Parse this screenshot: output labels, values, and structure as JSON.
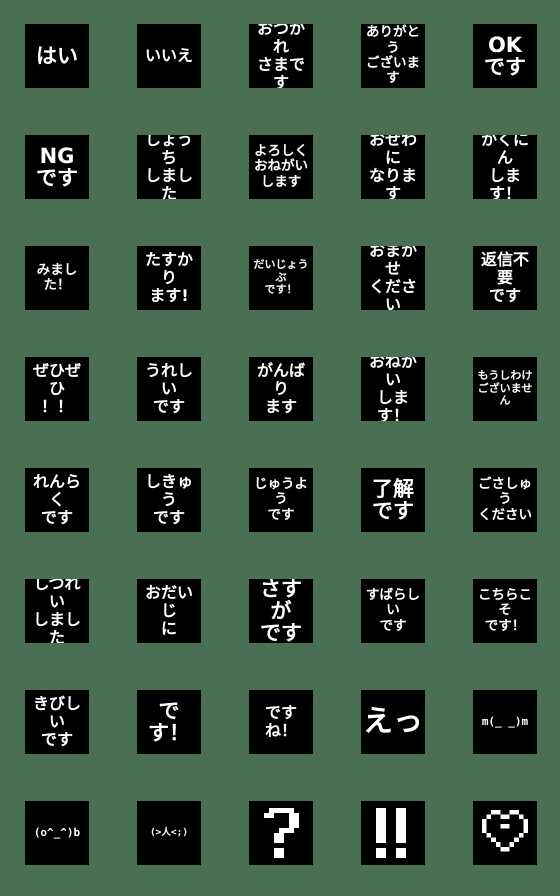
{
  "sheet": {
    "background_color": "#4a7054",
    "tile_color": "#000000",
    "text_color": "#ffffff",
    "columns": 5,
    "rows": 8,
    "tile_size_px": 64,
    "tile_count": 40,
    "style": "pixel bitmap font"
  },
  "stickers": [
    {
      "id": "r1c1",
      "text": "はい",
      "lines": [
        "はい"
      ],
      "size": "xl",
      "kind": "text"
    },
    {
      "id": "r1c2",
      "text": "いいえ",
      "lines": [
        "いいえ"
      ],
      "size": "lg",
      "kind": "text"
    },
    {
      "id": "r1c3",
      "text": "おつかれさまです",
      "lines": [
        "おつかれ",
        "さまです"
      ],
      "size": "lg",
      "kind": "text"
    },
    {
      "id": "r1c4",
      "text": "ありがとうございます",
      "lines": [
        "ありがとう",
        "ございます"
      ],
      "size": "md",
      "kind": "text"
    },
    {
      "id": "r1c5",
      "text": "OKです",
      "lines": [
        "OK",
        "です"
      ],
      "size": "xl",
      "kind": "text"
    },
    {
      "id": "r2c1",
      "text": "NGです",
      "lines": [
        "NG",
        "です"
      ],
      "size": "xl",
      "kind": "text"
    },
    {
      "id": "r2c2",
      "text": "しょうちしました",
      "lines": [
        "しょうち",
        "しました"
      ],
      "size": "lg",
      "kind": "text"
    },
    {
      "id": "r2c3",
      "text": "よろしくおねがいします",
      "lines": [
        "よろしく",
        "おねがい",
        "します"
      ],
      "size": "md",
      "kind": "text"
    },
    {
      "id": "r2c4",
      "text": "おせわになります",
      "lines": [
        "おせわに",
        "なります"
      ],
      "size": "lg",
      "kind": "text"
    },
    {
      "id": "r2c5",
      "text": "かくにんします！",
      "lines": [
        "かくにん",
        "します！"
      ],
      "size": "lg",
      "kind": "text"
    },
    {
      "id": "r3c1",
      "text": "みました！",
      "lines": [
        "みました！"
      ],
      "size": "md",
      "kind": "text"
    },
    {
      "id": "r3c2",
      "text": "たすかります!",
      "lines": [
        "たすかり",
        "ます!"
      ],
      "size": "lg",
      "kind": "text"
    },
    {
      "id": "r3c3",
      "text": "だいじょうぶです！",
      "lines": [
        "だいじょうぶ",
        "です！"
      ],
      "size": "sm",
      "kind": "text"
    },
    {
      "id": "r3c4",
      "text": "おまかせください",
      "lines": [
        "おまかせ",
        "ください"
      ],
      "size": "lg",
      "kind": "text"
    },
    {
      "id": "r3c5",
      "text": "返信不要です",
      "lines": [
        "返信不要",
        "です"
      ],
      "size": "lg",
      "kind": "text"
    },
    {
      "id": "r4c1",
      "text": "ぜひぜひ！！",
      "lines": [
        "ぜひぜひ",
        "！！"
      ],
      "size": "lg",
      "kind": "text"
    },
    {
      "id": "r4c2",
      "text": "うれしいです",
      "lines": [
        "うれしい",
        "です"
      ],
      "size": "lg",
      "kind": "text"
    },
    {
      "id": "r4c3",
      "text": "がんばります",
      "lines": [
        "がんばり",
        "ます"
      ],
      "size": "lg",
      "kind": "text"
    },
    {
      "id": "r4c4",
      "text": "おねがいします！",
      "lines": [
        "おねがい",
        "します！"
      ],
      "size": "lg",
      "kind": "text"
    },
    {
      "id": "r4c5",
      "text": "もうしわけございません",
      "lines": [
        "もうしわけ",
        "ございません"
      ],
      "size": "sm",
      "kind": "text"
    },
    {
      "id": "r5c1",
      "text": "れんらくです",
      "lines": [
        "れんらく",
        "です"
      ],
      "size": "lg",
      "kind": "text"
    },
    {
      "id": "r5c2",
      "text": "しきゅうです",
      "lines": [
        "しきゅう",
        "です"
      ],
      "size": "lg",
      "kind": "text"
    },
    {
      "id": "r5c3",
      "text": "じゅうようです",
      "lines": [
        "じゅうよう",
        "です"
      ],
      "size": "md",
      "kind": "text"
    },
    {
      "id": "r5c4",
      "text": "了解です",
      "lines": [
        "了解",
        "です"
      ],
      "size": "xl",
      "kind": "text"
    },
    {
      "id": "r5c5",
      "text": "ごさしゅうください",
      "lines": [
        "ごさしゅう",
        "ください"
      ],
      "size": "md",
      "kind": "text"
    },
    {
      "id": "r6c1",
      "text": "しつれいしました",
      "lines": [
        "しつれい",
        "しました"
      ],
      "size": "lg",
      "kind": "text"
    },
    {
      "id": "r6c2",
      "text": "おだいじに",
      "lines": [
        "おだいじ",
        "に"
      ],
      "size": "lg",
      "kind": "text"
    },
    {
      "id": "r6c3",
      "text": "さすがです",
      "lines": [
        "さすが",
        "です"
      ],
      "size": "xl",
      "kind": "text"
    },
    {
      "id": "r6c4",
      "text": "すばらしいです",
      "lines": [
        "すばらしい",
        "です"
      ],
      "size": "md",
      "kind": "text"
    },
    {
      "id": "r6c5",
      "text": "こちらこそです！",
      "lines": [
        "こちらこそ",
        "です！"
      ],
      "size": "md",
      "kind": "text"
    },
    {
      "id": "r7c1",
      "text": "きびしいです",
      "lines": [
        "きびしい",
        "です"
      ],
      "size": "lg",
      "kind": "text"
    },
    {
      "id": "r7c2",
      "text": "です！",
      "lines": [
        "です！"
      ],
      "size": "xl",
      "kind": "text"
    },
    {
      "id": "r7c3",
      "text": "ですね！",
      "lines": [
        "ですね！"
      ],
      "size": "lg",
      "kind": "text"
    },
    {
      "id": "r7c4",
      "text": "えっ",
      "lines": [
        "えっ"
      ],
      "size": "xxl",
      "kind": "text"
    },
    {
      "id": "r7c5",
      "text": "m(_ _)m",
      "lines": [
        "m(_ _)m"
      ],
      "size": "mono",
      "kind": "kaomoji"
    },
    {
      "id": "r8c1",
      "text": "(o^_^)b",
      "lines": [
        "(o^_^)b"
      ],
      "size": "mono",
      "kind": "kaomoji"
    },
    {
      "id": "r8c2",
      "text": "(>人<;)",
      "lines": [
        "(>人<;)"
      ],
      "size": "mono-sm",
      "kind": "kaomoji"
    },
    {
      "id": "r8c3",
      "text": "?",
      "lines": [
        "?"
      ],
      "size": "xxl",
      "kind": "symbol-question"
    },
    {
      "id": "r8c4",
      "text": "!!",
      "lines": [
        "!!"
      ],
      "size": "xxl",
      "kind": "symbol-exclaim"
    },
    {
      "id": "r8c5",
      "text": "♡",
      "lines": [
        "♡"
      ],
      "size": "xxl",
      "kind": "symbol-heart"
    }
  ]
}
